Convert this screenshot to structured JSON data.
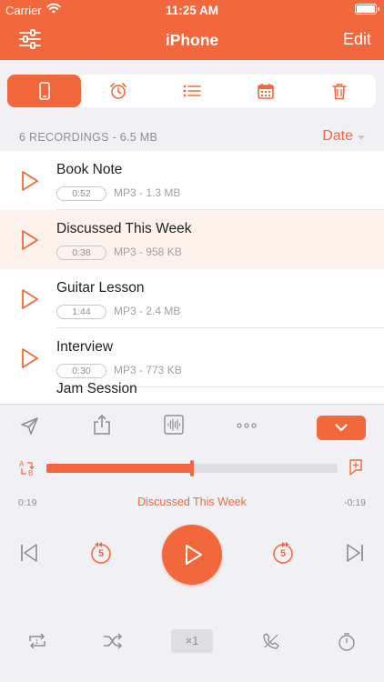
{
  "status_bar": {
    "carrier": "Carrier",
    "time": "11:25 AM"
  },
  "nav": {
    "title": "iPhone",
    "edit_label": "Edit"
  },
  "segments": [
    {
      "icon": "phone-icon",
      "active": true
    },
    {
      "icon": "alarm-icon",
      "active": false
    },
    {
      "icon": "list-icon",
      "active": false
    },
    {
      "icon": "calendar-icon",
      "active": false
    },
    {
      "icon": "trash-icon",
      "active": false
    }
  ],
  "list_header": {
    "count_text": "6 RECORDINGS - 6.5 MB",
    "sort_label": "Date"
  },
  "recordings": [
    {
      "name": "Book Note",
      "duration": "0:52",
      "meta": "MP3 - 1.3 MB",
      "selected": false
    },
    {
      "name": "Discussed This Week",
      "duration": "0:38",
      "meta": "MP3 - 958 KB",
      "selected": true
    },
    {
      "name": "Guitar Lesson",
      "duration": "1:44",
      "meta": "MP3 - 2.4 MB",
      "selected": false
    },
    {
      "name": "Interview",
      "duration": "0:30",
      "meta": "MP3 - 773 KB",
      "selected": false
    },
    {
      "name": "Jam Session",
      "duration": "",
      "meta": "",
      "selected": false
    }
  ],
  "toolbar": {
    "icons": [
      "send-icon",
      "share-icon",
      "waveform-icon",
      "more-icon",
      "collapse-chevron-icon"
    ]
  },
  "player": {
    "progress": 0.5,
    "elapsed": "0:19",
    "remaining": "-0:19",
    "now_playing": "Discussed This Week",
    "skip_back_seconds": "5",
    "skip_forward_seconds": "5",
    "speed_label": "×1"
  },
  "colors": {
    "accent": "#f2683c",
    "background": "#f1f0f5",
    "selected_row": "#fdf2ec"
  }
}
